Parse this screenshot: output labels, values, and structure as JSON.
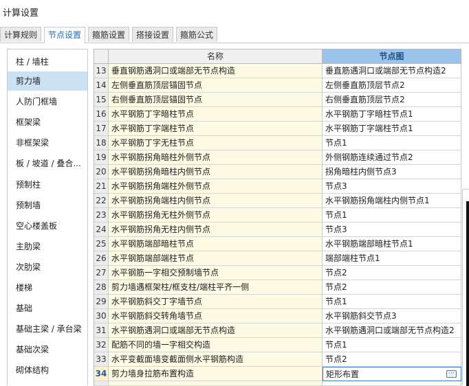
{
  "window": {
    "title": "计算设置"
  },
  "tabs": [
    {
      "label": "计算规则",
      "active": false
    },
    {
      "label": "节点设置",
      "active": true
    },
    {
      "label": "箍筋设置",
      "active": false
    },
    {
      "label": "搭接设置",
      "active": false
    },
    {
      "label": "箍筋公式",
      "active": false
    }
  ],
  "sidebar": {
    "items": [
      {
        "label": "柱 / 墙柱"
      },
      {
        "label": "剪力墙",
        "selected": true
      },
      {
        "label": "人防门框墙"
      },
      {
        "label": "框架梁"
      },
      {
        "label": "非框架梁"
      },
      {
        "label": "板 / 坡道 / 叠合..."
      },
      {
        "label": "预制柱"
      },
      {
        "label": "预制墙"
      },
      {
        "label": "空心楼盖板"
      },
      {
        "label": "主肋梁"
      },
      {
        "label": "次肋梁"
      },
      {
        "label": "楼梯"
      },
      {
        "label": "基础"
      },
      {
        "label": "基础主梁 / 承台梁"
      },
      {
        "label": "基础次梁"
      },
      {
        "label": "砌体结构"
      }
    ]
  },
  "table": {
    "headers": {
      "name": "名称",
      "node": "节点图"
    },
    "rows": [
      {
        "num": "13",
        "name": "垂直钢筋遇洞口或端部无节点构造",
        "node": "垂直筋遇洞口或端部无节点构造2"
      },
      {
        "num": "14",
        "name": "左侧垂直筋顶层锚固节点",
        "node": "左侧垂直筋顶层节点2"
      },
      {
        "num": "15",
        "name": "右侧垂直筋顶层锚固节点",
        "node": "右侧垂直筋顶层节点2"
      },
      {
        "num": "16",
        "name": "水平钢筋丁字暗柱节点",
        "node": "水平钢筋丁字暗柱节点1"
      },
      {
        "num": "17",
        "name": "水平钢筋丁字端柱节点",
        "node": "水平钢筋丁字端柱节点1"
      },
      {
        "num": "18",
        "name": "水平钢筋丁字无柱节点",
        "node": "节点1"
      },
      {
        "num": "19",
        "name": "水平钢筋拐角暗柱外侧节点",
        "node": "外侧钢筋连续通过节点2"
      },
      {
        "num": "20",
        "name": "水平钢筋拐角暗柱内侧节点",
        "node": "拐角暗柱内侧节点3"
      },
      {
        "num": "21",
        "name": "水平钢筋拐角端柱外侧节点",
        "node": "节点3"
      },
      {
        "num": "22",
        "name": "水平钢筋拐角端柱内侧节点",
        "node": "水平钢筋拐角端柱内侧节点1"
      },
      {
        "num": "23",
        "name": "水平钢筋拐角无柱外侧节点",
        "node": "节点1"
      },
      {
        "num": "24",
        "name": "水平钢筋拐角无柱内侧节点",
        "node": "节点3"
      },
      {
        "num": "25",
        "name": "水平钢筋端部暗柱节点",
        "node": "水平钢筋端部暗柱节点1"
      },
      {
        "num": "26",
        "name": "水平钢筋端部端柱节点",
        "node": "端部端柱节点1"
      },
      {
        "num": "27",
        "name": "水平钢筋一字相交预制墙节点",
        "node": "节点2"
      },
      {
        "num": "28",
        "name": "剪力墙遇框架柱/框支柱/端柱平齐一侧",
        "node": "节点2"
      },
      {
        "num": "29",
        "name": "水平钢筋斜交丁字墙节点",
        "node": "节点1"
      },
      {
        "num": "30",
        "name": "水平钢筋斜交转角墙节点",
        "node": "水平钢筋斜交节点3"
      },
      {
        "num": "31",
        "name": "水平钢筋遇洞口或端部无节点构造",
        "node": "水平钢筋遇洞口或端部无节点构造2"
      },
      {
        "num": "32",
        "name": "配筋不同的墙一字相交构造",
        "node": "节点1"
      },
      {
        "num": "33",
        "name": "水平变截面墙变截面侧水平钢筋构造",
        "node": "节点2"
      },
      {
        "num": "34",
        "name": "剪力墙身拉筋布置构造",
        "node": "矩形布置",
        "selected": true,
        "more": "···"
      }
    ]
  },
  "colors": {
    "accent": "#1f6fc1",
    "header_node_bg": "#9cc3ea",
    "name_cell_bg": "#fdfbe3",
    "sidebar_selected": "#cbe1f4"
  }
}
